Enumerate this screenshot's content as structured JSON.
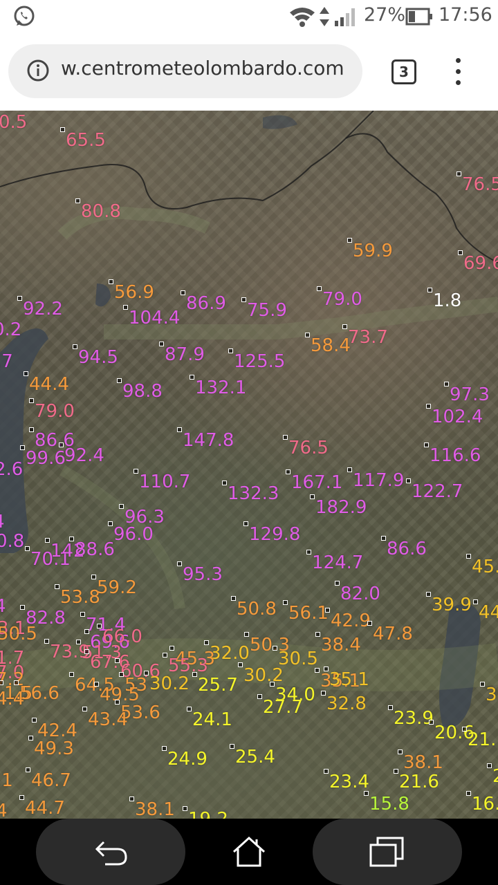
{
  "status_bar": {
    "notification_icon": "whatsapp-icon",
    "battery_percent": "27%",
    "time": "17:56"
  },
  "browser": {
    "url": "w.centrometeolombardo.com",
    "tab_count": "3",
    "icons": [
      "info-icon",
      "tabs-icon",
      "more-vert-icon"
    ]
  },
  "map": {
    "colors": {
      "pink": "#f06b8a",
      "orange": "#f59a3c",
      "magenta": "#e05ce6",
      "white": "#ffffff",
      "amber": "#f3c228",
      "yellow": "#f5f52a",
      "green": "#b8f53a"
    },
    "stations": [
      {
        "v": "0.5",
        "c": "pink"
      },
      {
        "v": "65.5",
        "c": "pink"
      },
      {
        "v": "76.5",
        "c": "pink"
      },
      {
        "v": "80.8",
        "c": "pink"
      },
      {
        "v": "59.9",
        "c": "orange"
      },
      {
        "v": "69.6",
        "c": "pink"
      },
      {
        "v": "56.9",
        "c": "orange"
      },
      {
        "v": "1.8",
        "c": "white"
      },
      {
        "v": "92.2",
        "c": "magenta"
      },
      {
        "v": "104.4",
        "c": "magenta"
      },
      {
        "v": "86.9",
        "c": "magenta"
      },
      {
        "v": "75.9",
        "c": "magenta"
      },
      {
        "v": "79.0",
        "c": "magenta"
      },
      {
        "v": "0.2",
        "c": "magenta"
      },
      {
        "v": "73.7",
        "c": "pink"
      },
      {
        "v": "58.4",
        "c": "orange"
      },
      {
        "v": ".7",
        "c": "magenta"
      },
      {
        "v": "94.5",
        "c": "magenta"
      },
      {
        "v": "87.9",
        "c": "magenta"
      },
      {
        "v": "125.5",
        "c": "magenta"
      },
      {
        "v": "44.4",
        "c": "orange"
      },
      {
        "v": "98.8",
        "c": "magenta"
      },
      {
        "v": "132.1",
        "c": "magenta"
      },
      {
        "v": "97.3",
        "c": "magenta"
      },
      {
        "v": "79.0",
        "c": "pink"
      },
      {
        "v": "102.4",
        "c": "magenta"
      },
      {
        "v": "86.6",
        "c": "magenta"
      },
      {
        "v": "147.8",
        "c": "magenta"
      },
      {
        "v": "76.5",
        "c": "pink"
      },
      {
        "v": "99.6",
        "c": "magenta"
      },
      {
        "v": "92.4",
        "c": "magenta"
      },
      {
        "v": "116.6",
        "c": "magenta"
      },
      {
        "v": "2.6",
        "c": "magenta"
      },
      {
        "v": "110.7",
        "c": "magenta"
      },
      {
        "v": "167.1",
        "c": "magenta"
      },
      {
        "v": "117.9",
        "c": "magenta"
      },
      {
        "v": "132.3",
        "c": "magenta"
      },
      {
        "v": "122.7",
        "c": "magenta"
      },
      {
        "v": "182.9",
        "c": "magenta"
      },
      {
        "v": "4",
        "c": "magenta"
      },
      {
        "v": "96.3",
        "c": "magenta"
      },
      {
        "v": "96.0",
        "c": "magenta"
      },
      {
        "v": "129.8",
        "c": "magenta"
      },
      {
        "v": "0.8",
        "c": "magenta"
      },
      {
        "v": "70.1",
        "c": "magenta"
      },
      {
        "v": "142",
        "c": "magenta"
      },
      {
        "v": "88.6",
        "c": "magenta"
      },
      {
        "v": "86.6",
        "c": "magenta"
      },
      {
        "v": "45.",
        "c": "amber"
      },
      {
        "v": "124.7",
        "c": "magenta"
      },
      {
        "v": "95.3",
        "c": "magenta"
      },
      {
        "v": "82.0",
        "c": "magenta"
      },
      {
        "v": "53.8",
        "c": "orange"
      },
      {
        "v": "59.2",
        "c": "orange"
      },
      {
        "v": "39.9",
        "c": "amber"
      },
      {
        "v": "4",
        "c": "magenta"
      },
      {
        "v": "50.8",
        "c": "orange"
      },
      {
        "v": "56.1",
        "c": "orange"
      },
      {
        "v": "42.9",
        "c": "orange"
      },
      {
        "v": "44",
        "c": "amber"
      },
      {
        "v": "82.8",
        "c": "magenta"
      },
      {
        "v": "71.4",
        "c": "magenta"
      },
      {
        "v": "47.8",
        "c": "orange"
      },
      {
        "v": "3.1",
        "c": "pink"
      },
      {
        "v": "50.5",
        "c": "orange"
      },
      {
        "v": "69.6",
        "c": "magenta"
      },
      {
        "v": "66.0",
        "c": "pink"
      },
      {
        "v": "50.3",
        "c": "orange"
      },
      {
        "v": "38.4",
        "c": "orange"
      },
      {
        "v": "73.9",
        "c": "pink"
      },
      {
        "v": "51.3",
        "c": "pink"
      },
      {
        "v": "32.0",
        "c": "amber"
      },
      {
        "v": "1.7",
        "c": "pink"
      },
      {
        "v": "67.6",
        "c": "pink"
      },
      {
        "v": "45.3",
        "c": "orange"
      },
      {
        "v": "30.5",
        "c": "amber"
      },
      {
        "v": "7.0",
        "c": "pink"
      },
      {
        "v": "60.6",
        "c": "pink"
      },
      {
        "v": "55.3",
        "c": "pink"
      },
      {
        "v": "30.2",
        "c": "amber"
      },
      {
        "v": "35.1",
        "c": "orange"
      },
      {
        "v": "35.1",
        "c": "amber"
      },
      {
        "v": "7.2",
        "c": "orange"
      },
      {
        "v": "64.5",
        "c": "orange"
      },
      {
        "v": "53",
        "c": "orange"
      },
      {
        "v": "30.2",
        "c": "amber"
      },
      {
        "v": "25.7",
        "c": "yellow"
      },
      {
        "v": "3",
        "c": "amber"
      },
      {
        "v": "56.6",
        "c": "orange"
      },
      {
        "v": "49.5",
        "c": "orange"
      },
      {
        "v": "34.0",
        "c": "yellow"
      },
      {
        "v": "32.8",
        "c": "amber"
      },
      {
        "v": "4.4",
        "c": "orange"
      },
      {
        "v": "1.5",
        "c": "orange"
      },
      {
        "v": "27.7",
        "c": "yellow"
      },
      {
        "v": "53.6",
        "c": "orange"
      },
      {
        "v": "43.4",
        "c": "orange"
      },
      {
        "v": "24.1",
        "c": "yellow"
      },
      {
        "v": "23.9",
        "c": "yellow"
      },
      {
        "v": "20.6",
        "c": "yellow"
      },
      {
        "v": "21.",
        "c": "yellow"
      },
      {
        "v": "42.4",
        "c": "orange"
      },
      {
        "v": "49.3",
        "c": "orange"
      },
      {
        "v": "24.9",
        "c": "yellow"
      },
      {
        "v": "25.4",
        "c": "yellow"
      },
      {
        "v": "38.1",
        "c": "orange"
      },
      {
        "v": ".1",
        "c": "orange"
      },
      {
        "v": "46.7",
        "c": "orange"
      },
      {
        "v": "23.4",
        "c": "yellow"
      },
      {
        "v": "21.6",
        "c": "yellow"
      },
      {
        "v": "2",
        "c": "yellow"
      },
      {
        "v": "44.7",
        "c": "orange"
      },
      {
        "v": "38.1",
        "c": "orange"
      },
      {
        "v": "19.2",
        "c": "yellow"
      },
      {
        "v": "15.8",
        "c": "green"
      },
      {
        "v": "16.",
        "c": "yellow"
      },
      {
        "v": "4",
        "c": "orange"
      }
    ]
  },
  "nav_bar": {
    "icons": [
      "back-icon",
      "home-icon",
      "recent-apps-icon"
    ]
  }
}
